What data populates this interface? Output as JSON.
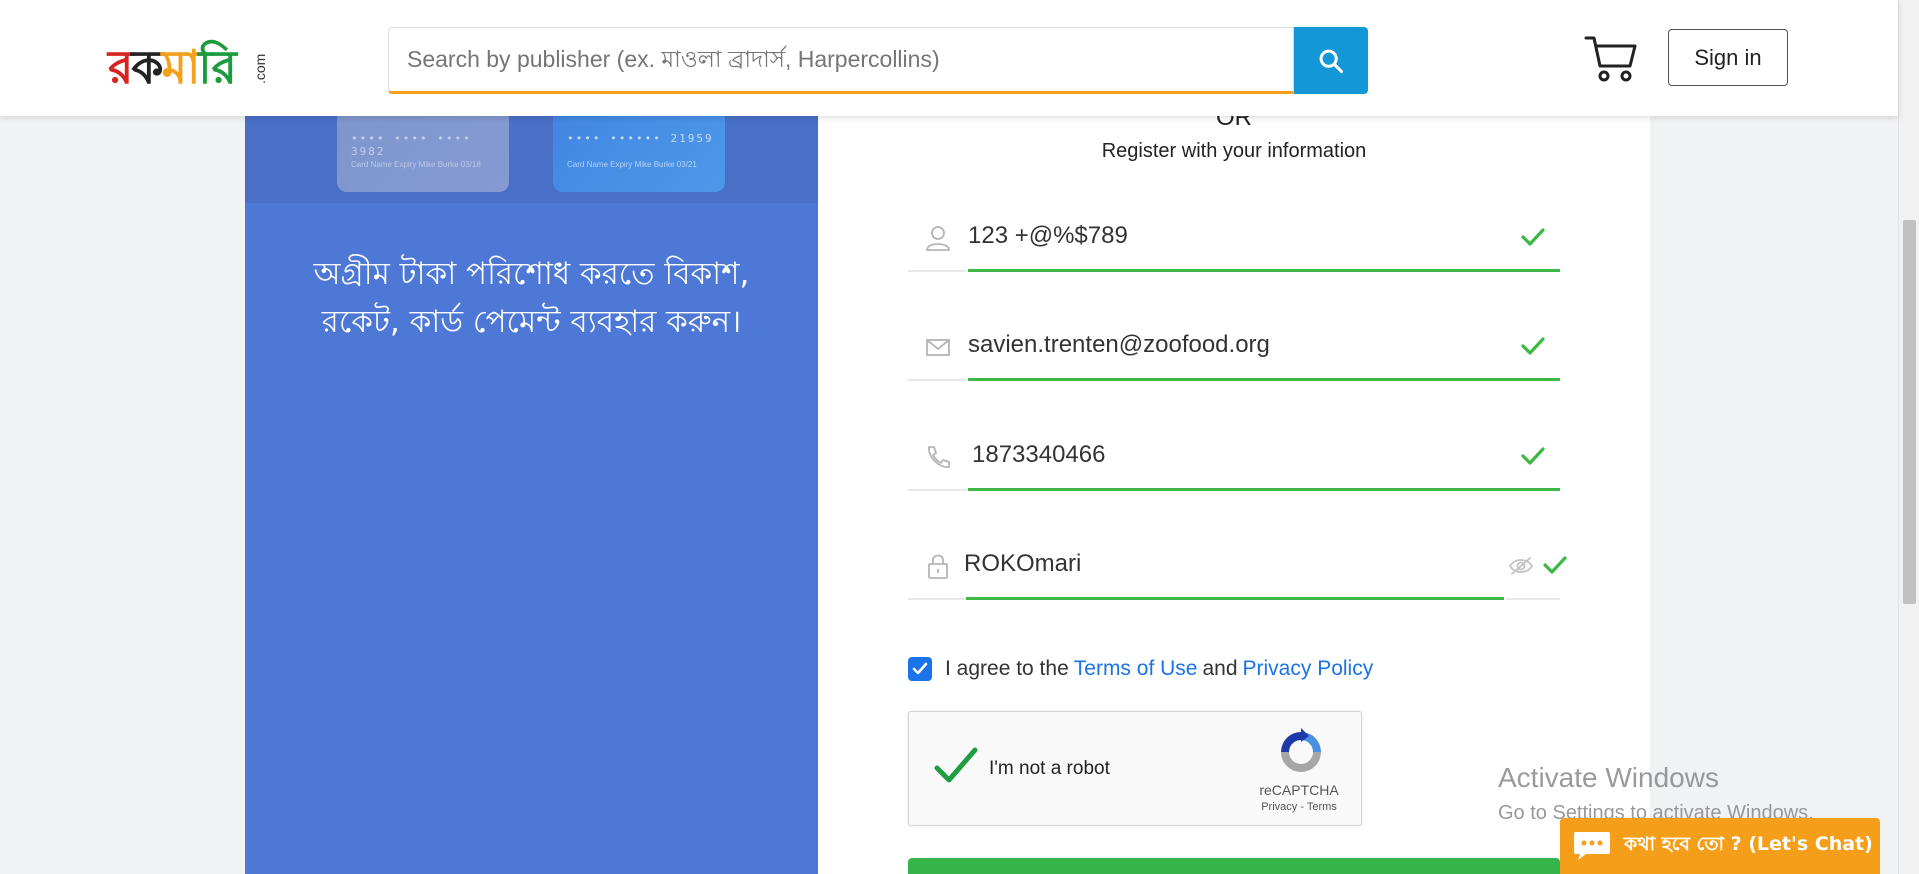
{
  "header": {
    "logo": {
      "parts": [
        "র",
        "ক",
        "মা",
        "রি"
      ],
      "suffix": ".com"
    },
    "search": {
      "placeholder": "Search by publisher (ex. মাওলা ব্রাদার্স, Harpercollins)",
      "icon": "search-icon"
    },
    "cart_icon": "cart-icon",
    "signin_label": "Sign in"
  },
  "promo": {
    "cards": [
      {
        "number": "•••• •••• •••• 3982",
        "name": "Card Name   Expiry\nMike Burke  03/18"
      },
      {
        "number": "•••• ••••••  21959",
        "name": "Card Name   Expiry\nMike Burke  03/21"
      }
    ],
    "text": "অগ্রীম টাকা পরিশোধ করতে বিকাশ, রকেট, কার্ড পেমেন্ট ব্যবহার করুন।"
  },
  "form": {
    "or_label": "OR",
    "register_label": "Register with your information",
    "fields": [
      {
        "icon": "user-icon",
        "value": "123 +@%$789",
        "valid": true
      },
      {
        "icon": "envelope-icon",
        "value": "savien.trenten@zoofood.org",
        "valid": true
      },
      {
        "icon": "phone-icon",
        "value": "1873340466",
        "valid": true
      },
      {
        "icon": "lock-icon",
        "value": "ROKOmari",
        "valid": true
      }
    ],
    "agree": {
      "checked": true,
      "prefix": "I agree to the",
      "terms_link": "Terms of Use",
      "and": "and",
      "privacy_link": "Privacy Policy"
    },
    "recaptcha": {
      "label": "I'm not a robot",
      "brand": "reCAPTCHA",
      "privacy": "Privacy",
      "separator": " - ",
      "terms": "Terms"
    }
  },
  "watermark": {
    "title": "Activate Windows",
    "subtitle": "Go to Settings to activate Windows."
  },
  "chat": {
    "label": "কথা হবে তো ? (Let's Chat)",
    "icon": "chat-bubble-icon"
  },
  "colors": {
    "accent_orange": "#f59e1a",
    "search_blue": "#1497d6",
    "promo_blue": "#4e78d6",
    "valid_green": "#3cb843",
    "link_blue": "#1a73e8"
  }
}
